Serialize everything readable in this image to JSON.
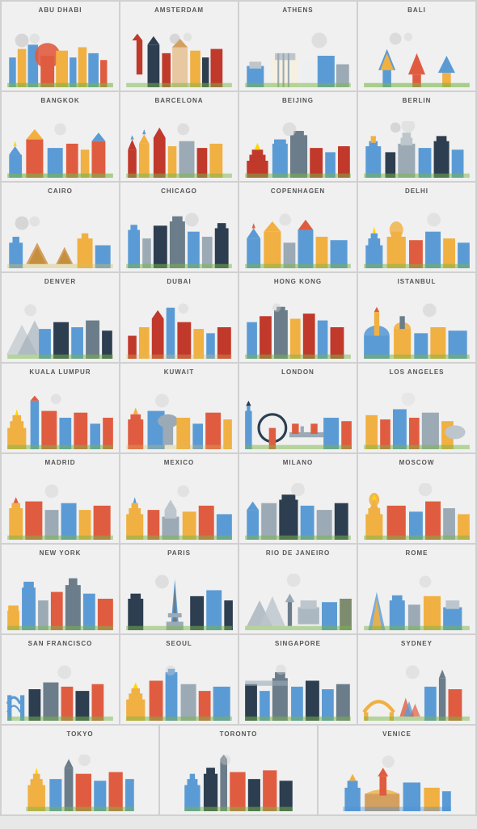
{
  "cities": [
    {
      "name": "ABU DHABI",
      "color1": "#5b9bd5",
      "color2": "#f0b042",
      "color3": "#e05c40"
    },
    {
      "name": "AMSTERDAM",
      "color1": "#c0392b",
      "color2": "#2c3e50",
      "color3": "#f0b042"
    },
    {
      "name": "ATHENS",
      "color1": "#5b9bd5",
      "color2": "#ecf0f1",
      "color3": "#f0b042"
    },
    {
      "name": "BALI",
      "color1": "#5b9bd5",
      "color2": "#f0b042",
      "color3": "#e05c40"
    },
    {
      "name": "BANGKOK",
      "color1": "#e05c40",
      "color2": "#f0b042",
      "color3": "#5b9bd5"
    },
    {
      "name": "BARCELONA",
      "color1": "#c0392b",
      "color2": "#f0b042",
      "color3": "#5b9bd5"
    },
    {
      "name": "BEIJING",
      "color1": "#c0392b",
      "color2": "#5b9bd5",
      "color3": "#f0b042"
    },
    {
      "name": "BERLIN",
      "color1": "#2c3e50",
      "color2": "#5b9bd5",
      "color3": "#f0b042"
    },
    {
      "name": "CAIRO",
      "color1": "#5b9bd5",
      "color2": "#f0b042",
      "color3": "#e05c40"
    },
    {
      "name": "CHICAGO",
      "color1": "#2c3e50",
      "color2": "#5b9bd5",
      "color3": "#f0b042"
    },
    {
      "name": "COPENHAGEN",
      "color1": "#5b9bd5",
      "color2": "#f0b042",
      "color3": "#e05c40"
    },
    {
      "name": "DELHI",
      "color1": "#5b9bd5",
      "color2": "#f0b042",
      "color3": "#e05c40"
    },
    {
      "name": "DENVER",
      "color1": "#5b9bd5",
      "color2": "#2c3e50",
      "color3": "#f0b042"
    },
    {
      "name": "DUBAI",
      "color1": "#c0392b",
      "color2": "#5b9bd5",
      "color3": "#f0b042"
    },
    {
      "name": "HONG KONG",
      "color1": "#c0392b",
      "color2": "#5b9bd5",
      "color3": "#f0b042"
    },
    {
      "name": "ISTANBUL",
      "color1": "#5b9bd5",
      "color2": "#f0b042",
      "color3": "#e05c40"
    },
    {
      "name": "KUALA LUMPUR",
      "color1": "#e05c40",
      "color2": "#5b9bd5",
      "color3": "#f0b042"
    },
    {
      "name": "KUWAIT",
      "color1": "#f0b042",
      "color2": "#5b9bd5",
      "color3": "#e05c40"
    },
    {
      "name": "LONDON",
      "color1": "#e05c40",
      "color2": "#5b9bd5",
      "color3": "#2c3e50"
    },
    {
      "name": "LOS ANGELES",
      "color1": "#e05c40",
      "color2": "#5b9bd5",
      "color3": "#f0b042"
    },
    {
      "name": "MADRID",
      "color1": "#e05c40",
      "color2": "#5b9bd5",
      "color3": "#f0b042"
    },
    {
      "name": "MEXICO",
      "color1": "#e05c40",
      "color2": "#f0b042",
      "color3": "#5b9bd5"
    },
    {
      "name": "MILANO",
      "color1": "#2c3e50",
      "color2": "#5b9bd5",
      "color3": "#f0b042"
    },
    {
      "name": "MOSCOW",
      "color1": "#e05c40",
      "color2": "#5b9bd5",
      "color3": "#f0b042"
    },
    {
      "name": "NEW YORK",
      "color1": "#e05c40",
      "color2": "#5b9bd5",
      "color3": "#f0b042"
    },
    {
      "name": "PARIS",
      "color1": "#2c3e50",
      "color2": "#5b9bd5",
      "color3": "#f0b042"
    },
    {
      "name": "RIO DE JANEIRO",
      "color1": "#5b9bd5",
      "color2": "#7d8c6e",
      "color3": "#f0b042"
    },
    {
      "name": "ROME",
      "color1": "#5b9bd5",
      "color2": "#f0b042",
      "color3": "#e05c40"
    },
    {
      "name": "SAN FRANCISCO",
      "color1": "#e05c40",
      "color2": "#2c3e50",
      "color3": "#5b9bd5"
    },
    {
      "name": "SEOUL",
      "color1": "#e05c40",
      "color2": "#5b9bd5",
      "color3": "#f0b042"
    },
    {
      "name": "SINGAPORE",
      "color1": "#5b9bd5",
      "color2": "#2c3e50",
      "color3": "#f0b042"
    },
    {
      "name": "SYDNEY",
      "color1": "#e05c40",
      "color2": "#5b9bd5",
      "color3": "#f0b042"
    },
    {
      "name": "TOKYO",
      "color1": "#e05c40",
      "color2": "#5b9bd5",
      "color3": "#f0b042"
    },
    {
      "name": "TORONTO",
      "color1": "#e05c40",
      "color2": "#2c3e50",
      "color3": "#5b9bd5"
    },
    {
      "name": "VENICE",
      "color1": "#f0b042",
      "color2": "#5b9bd5",
      "color3": "#e05c40"
    }
  ]
}
